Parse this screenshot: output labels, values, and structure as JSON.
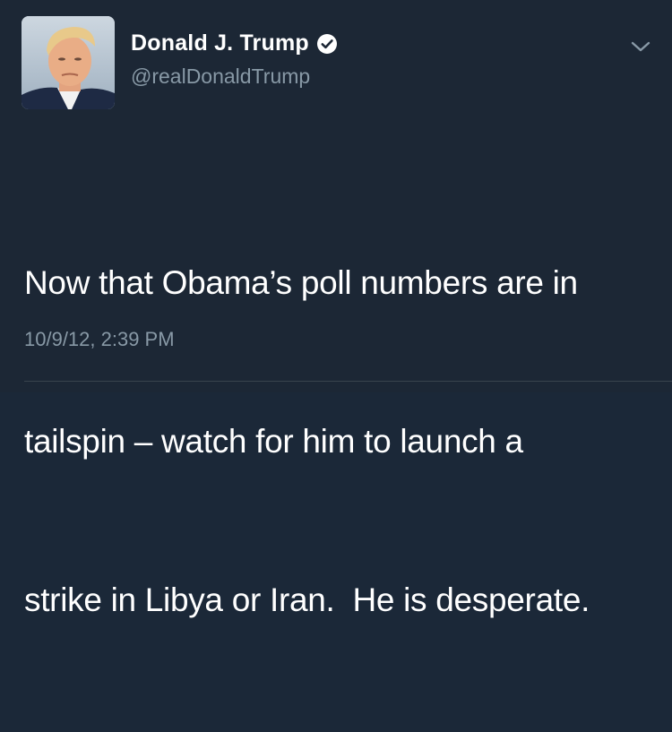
{
  "author": {
    "display_name": "Donald J. Trump",
    "handle": "@realDonaldTrump",
    "verified": true,
    "avatar_icon": "profile-photo"
  },
  "tweet": {
    "lines": [
      "Now that Obama’s poll numbers are in",
      "tailspin – watch for him to launch a",
      "strike in Libya or Iran.  He is desperate."
    ],
    "timestamp": "10/9/12, 2:39 PM"
  },
  "icons": {
    "verified": "verified-badge-icon",
    "menu": "chevron-down-icon"
  },
  "colors": {
    "background": "#1c2735",
    "text_primary": "#ffffff",
    "text_secondary": "#8899a6"
  }
}
